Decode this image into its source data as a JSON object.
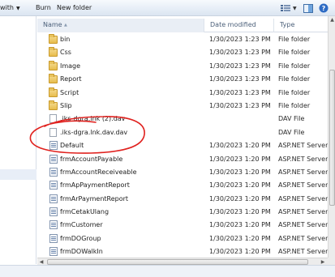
{
  "toolbar": {
    "share_with_label": "with",
    "burn_label": "Burn",
    "new_folder_label": "New folder"
  },
  "columns": {
    "name": "Name",
    "date_modified": "Date modified",
    "type": "Type"
  },
  "files": [
    {
      "name": "bin",
      "date": "1/30/2023 1:23 PM",
      "type": "File folder",
      "icon": "folder-icon"
    },
    {
      "name": "Css",
      "date": "1/30/2023 1:23 PM",
      "type": "File folder",
      "icon": "folder-icon"
    },
    {
      "name": "Image",
      "date": "1/30/2023 1:23 PM",
      "type": "File folder",
      "icon": "folder-icon"
    },
    {
      "name": "Report",
      "date": "1/30/2023 1:23 PM",
      "type": "File folder",
      "icon": "folder-icon"
    },
    {
      "name": "Script",
      "date": "1/30/2023 1:23 PM",
      "type": "File folder",
      "icon": "folder-icon"
    },
    {
      "name": "Slip",
      "date": "1/30/2023 1:23 PM",
      "type": "File folder",
      "icon": "folder-icon"
    },
    {
      "name": ".iks-dgra.lnk (2).dav",
      "date": "",
      "type": "DAV File",
      "icon": "file-icon"
    },
    {
      "name": ".iks-dgra.lnk.dav.dav",
      "date": "",
      "type": "DAV File",
      "icon": "file-icon"
    },
    {
      "name": "Default",
      "date": "1/30/2023 1:20 PM",
      "type": "ASP.NET Server",
      "icon": "aspx-page-icon"
    },
    {
      "name": "frmAccountPayable",
      "date": "1/30/2023 1:20 PM",
      "type": "ASP.NET Server",
      "icon": "aspx-page-icon"
    },
    {
      "name": "frmAccountReceiveable",
      "date": "1/30/2023 1:20 PM",
      "type": "ASP.NET Server",
      "icon": "aspx-page-icon"
    },
    {
      "name": "frmApPaymentReport",
      "date": "1/30/2023 1:20 PM",
      "type": "ASP.NET Server",
      "icon": "aspx-page-icon"
    },
    {
      "name": "frmArPaymentReport",
      "date": "1/30/2023 1:20 PM",
      "type": "ASP.NET Server",
      "icon": "aspx-page-icon"
    },
    {
      "name": "frmCetakUlang",
      "date": "1/30/2023 1:20 PM",
      "type": "ASP.NET Server",
      "icon": "aspx-page-icon"
    },
    {
      "name": "frmCustomer",
      "date": "1/30/2023 1:20 PM",
      "type": "ASP.NET Server",
      "icon": "aspx-page-icon"
    },
    {
      "name": "frmDOGroup",
      "date": "1/30/2023 1:20 PM",
      "type": "ASP.NET Server",
      "icon": "aspx-page-icon"
    },
    {
      "name": "frmDOWalkIn",
      "date": "1/30/2023 1:20 PM",
      "type": "ASP.NET Server",
      "icon": "aspx-page-icon"
    }
  ],
  "colors": {
    "annotation": "#e0221f",
    "header_text": "#4c607a",
    "folder": "#e8bd4d"
  }
}
